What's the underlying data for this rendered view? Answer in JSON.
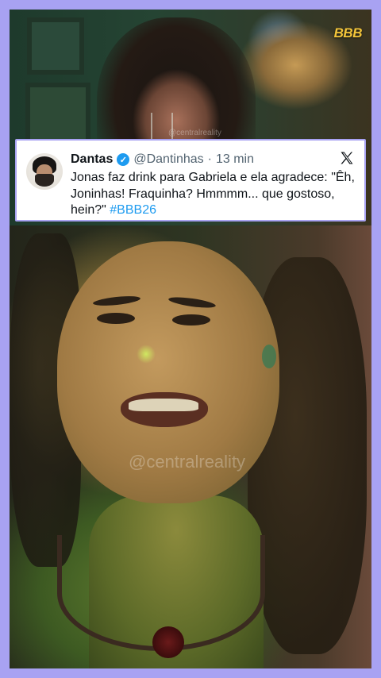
{
  "brand": {
    "logo_text": "BBB"
  },
  "video": {
    "small_watermark": "@centralreality",
    "watermark": "@centralreality"
  },
  "tweet": {
    "display_name": "Dantas",
    "verified": true,
    "handle": "@Dantinhas",
    "separator": "·",
    "time": "13 min",
    "text": "Jonas faz drink para Gabriela e ela agradece: \"Êh, Joninhas! Fraquinha? Hmmmm... que gostoso, hein?\"",
    "hashtag": "#BBB26"
  },
  "colors": {
    "border_accent": "#a8a2f2",
    "verified_badge": "#1d9bf0",
    "hashtag": "#1d9bf0",
    "logo": "#f3c53a"
  },
  "icons": {
    "verified": "verified-badge-icon",
    "platform": "x-logo-icon"
  }
}
